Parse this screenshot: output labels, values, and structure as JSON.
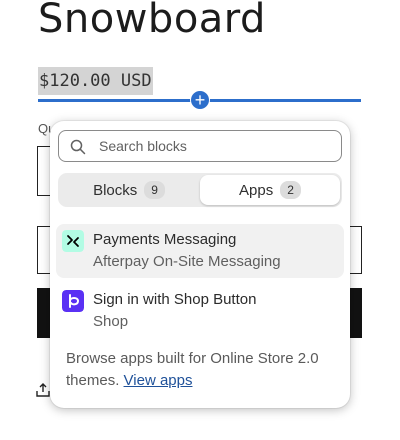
{
  "product": {
    "title": "Snowboard",
    "price": "$120.00 USD",
    "quantity_label_partial": "Qu"
  },
  "insert_button": {
    "symbol": "+"
  },
  "popover": {
    "search": {
      "placeholder": "Search blocks",
      "value": ""
    },
    "tabs": [
      {
        "label": "Blocks",
        "count": "9",
        "active": false
      },
      {
        "label": "Apps",
        "count": "2",
        "active": true
      }
    ],
    "apps": [
      {
        "name": "Payments Messaging",
        "subtitle": "Afterpay On-Site Messaging",
        "icon": "afterpay-icon",
        "icon_bg": "#b2fce4",
        "selected": true
      },
      {
        "name": "Sign in with Shop Button",
        "subtitle": "Shop",
        "icon": "shop-icon",
        "icon_bg": "#5a31f4",
        "selected": false
      }
    ],
    "footer": {
      "text": "Browse apps built for Online Store 2.0 themes.",
      "link": "View apps"
    }
  },
  "colors": {
    "accent": "#2c6ecb",
    "link": "#1f5199"
  }
}
